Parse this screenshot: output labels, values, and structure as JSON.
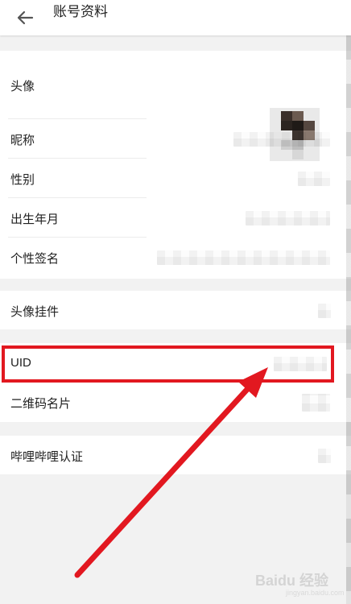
{
  "header": {
    "title": "账号资料"
  },
  "profile_items": {
    "avatar": "头像",
    "nickname": "昵称",
    "gender": "性别",
    "birthday": "出生年月",
    "signature": "个性签名",
    "avatar_pendant": "头像挂件",
    "uid": "UID",
    "qr_card": "二维码名片",
    "bilibili_verify": "哔哩哔哩认证"
  },
  "colors": {
    "highlight": "#e21820",
    "background": "#f2f2f2",
    "panel": "#ffffff"
  },
  "watermark": {
    "text": "Baidu 经验"
  }
}
